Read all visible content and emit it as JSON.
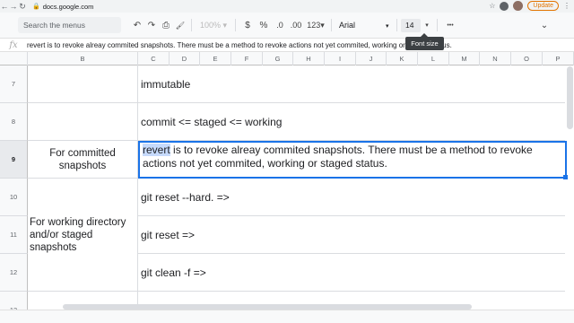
{
  "browser": {
    "url": "docs.google.com",
    "update_label": "Update",
    "menu_dots": "⋮"
  },
  "toolbar": {
    "search_placeholder": "Search the menus (Option+/)",
    "undo": "↶",
    "redo": "↷",
    "print": "⎙",
    "paint_format": "🖌",
    "zoom": "100%",
    "currency": "$",
    "percent": "%",
    "decrease_decimals": ".0",
    "increase_decimals": ".00",
    "more_formats": "123",
    "font_name": "Arial",
    "font_size": "14",
    "more": "•••",
    "collapse": "⌄",
    "tooltip": "Font size"
  },
  "formula_bar": {
    "fx_label": "fx",
    "text": "revert is to revoke alreay commited snapshots. There must be a method to revoke actions not yet commited, working or staged status."
  },
  "columns": [
    "B",
    "C",
    "D",
    "E",
    "F",
    "G",
    "H",
    "I",
    "J",
    "K",
    "L",
    "M",
    "N",
    "O",
    "P"
  ],
  "rows": [
    {
      "num": "7",
      "b": "",
      "c": "immutable"
    },
    {
      "num": "8",
      "b": "",
      "c": "commit <= staged <= working"
    },
    {
      "num": "9",
      "b": "For committed snapshots",
      "c_highlight": "revert",
      "c_rest": " is to revoke alreay commited snapshots. There must be a method to revoke actions not yet commited, working or staged status."
    },
    {
      "num": "10",
      "c": "git reset --hard. =>"
    },
    {
      "num": "11",
      "b": "For working directory and/or staged snapshots",
      "c": "git reset   =>"
    },
    {
      "num": "12",
      "c": "git clean -f =>"
    },
    {
      "num": "13",
      "c": ""
    }
  ]
}
